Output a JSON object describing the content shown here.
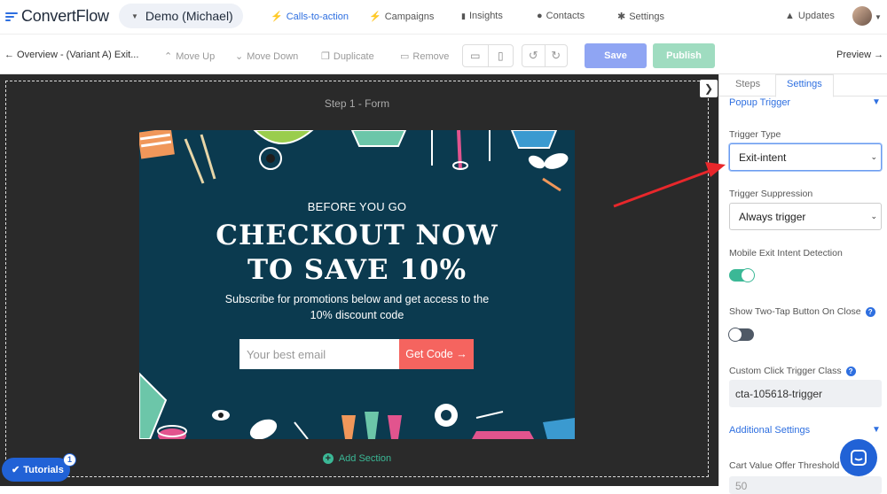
{
  "brand": {
    "logo_text": "ConvertFlow",
    "accent": "#2e6fe0"
  },
  "account": {
    "label": "Demo (Michael)"
  },
  "nav": {
    "items": [
      {
        "label": "Calls-to-action",
        "icon": "bolt-icon"
      },
      {
        "label": "Campaigns",
        "icon": "bolt-icon"
      },
      {
        "label": "Insights",
        "icon": "bar-chart-icon"
      },
      {
        "label": "Contacts",
        "icon": "user-icon"
      },
      {
        "label": "Settings",
        "icon": "gear-icon"
      }
    ],
    "updates": "Updates"
  },
  "toolbar": {
    "breadcrumb": "← Overview - (Variant A) Exit...",
    "move_up": "Move Up",
    "move_down": "Move Down",
    "duplicate": "Duplicate",
    "remove": "Remove",
    "save": "Save",
    "publish": "Publish",
    "preview": "Preview →"
  },
  "canvas": {
    "step_label": "Step 1 - Form",
    "add_section": "Add Section"
  },
  "popup": {
    "eyebrow": "BEFORE YOU GO",
    "headline_line1": "CHECKOUT NOW",
    "headline_line2": "TO SAVE 10%",
    "subtext": "Subscribe for promotions below and get access to the 10% discount code",
    "email_placeholder": "Your best email",
    "cta_label": "Get Code →",
    "bg_color": "#0b3a4f",
    "cta_color": "#f5645f"
  },
  "sidebar": {
    "tabs": [
      "Steps",
      "Settings"
    ],
    "active_tab": "Settings",
    "section_popup_trigger": "Popup Trigger",
    "trigger_type_label": "Trigger Type",
    "trigger_type_value": "Exit-intent",
    "trigger_suppression_label": "Trigger Suppression",
    "trigger_suppression_value": "Always trigger",
    "mobile_exit_label": "Mobile Exit Intent Detection",
    "mobile_exit_on": true,
    "two_tap_label": "Show Two-Tap Button On Close",
    "two_tap_on": false,
    "custom_class_label": "Custom Click Trigger Class",
    "custom_class_value": "cta-105618-trigger",
    "section_additional": "Additional Settings",
    "cart_value_label": "Cart Value Offer Threshold",
    "cart_value_value": "50"
  },
  "tutorials": {
    "label": "Tutorials",
    "badge": "1"
  }
}
